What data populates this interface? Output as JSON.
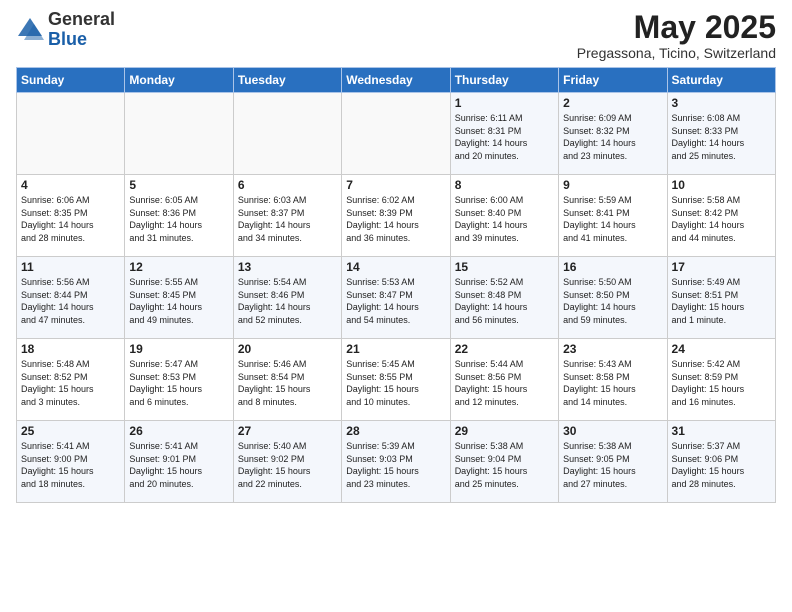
{
  "logo": {
    "general": "General",
    "blue": "Blue"
  },
  "title": "May 2025",
  "subtitle": "Pregassona, Ticino, Switzerland",
  "days_header": [
    "Sunday",
    "Monday",
    "Tuesday",
    "Wednesday",
    "Thursday",
    "Friday",
    "Saturday"
  ],
  "weeks": [
    [
      {
        "day": "",
        "info": ""
      },
      {
        "day": "",
        "info": ""
      },
      {
        "day": "",
        "info": ""
      },
      {
        "day": "",
        "info": ""
      },
      {
        "day": "1",
        "info": "Sunrise: 6:11 AM\nSunset: 8:31 PM\nDaylight: 14 hours\nand 20 minutes."
      },
      {
        "day": "2",
        "info": "Sunrise: 6:09 AM\nSunset: 8:32 PM\nDaylight: 14 hours\nand 23 minutes."
      },
      {
        "day": "3",
        "info": "Sunrise: 6:08 AM\nSunset: 8:33 PM\nDaylight: 14 hours\nand 25 minutes."
      }
    ],
    [
      {
        "day": "4",
        "info": "Sunrise: 6:06 AM\nSunset: 8:35 PM\nDaylight: 14 hours\nand 28 minutes."
      },
      {
        "day": "5",
        "info": "Sunrise: 6:05 AM\nSunset: 8:36 PM\nDaylight: 14 hours\nand 31 minutes."
      },
      {
        "day": "6",
        "info": "Sunrise: 6:03 AM\nSunset: 8:37 PM\nDaylight: 14 hours\nand 34 minutes."
      },
      {
        "day": "7",
        "info": "Sunrise: 6:02 AM\nSunset: 8:39 PM\nDaylight: 14 hours\nand 36 minutes."
      },
      {
        "day": "8",
        "info": "Sunrise: 6:00 AM\nSunset: 8:40 PM\nDaylight: 14 hours\nand 39 minutes."
      },
      {
        "day": "9",
        "info": "Sunrise: 5:59 AM\nSunset: 8:41 PM\nDaylight: 14 hours\nand 41 minutes."
      },
      {
        "day": "10",
        "info": "Sunrise: 5:58 AM\nSunset: 8:42 PM\nDaylight: 14 hours\nand 44 minutes."
      }
    ],
    [
      {
        "day": "11",
        "info": "Sunrise: 5:56 AM\nSunset: 8:44 PM\nDaylight: 14 hours\nand 47 minutes."
      },
      {
        "day": "12",
        "info": "Sunrise: 5:55 AM\nSunset: 8:45 PM\nDaylight: 14 hours\nand 49 minutes."
      },
      {
        "day": "13",
        "info": "Sunrise: 5:54 AM\nSunset: 8:46 PM\nDaylight: 14 hours\nand 52 minutes."
      },
      {
        "day": "14",
        "info": "Sunrise: 5:53 AM\nSunset: 8:47 PM\nDaylight: 14 hours\nand 54 minutes."
      },
      {
        "day": "15",
        "info": "Sunrise: 5:52 AM\nSunset: 8:48 PM\nDaylight: 14 hours\nand 56 minutes."
      },
      {
        "day": "16",
        "info": "Sunrise: 5:50 AM\nSunset: 8:50 PM\nDaylight: 14 hours\nand 59 minutes."
      },
      {
        "day": "17",
        "info": "Sunrise: 5:49 AM\nSunset: 8:51 PM\nDaylight: 15 hours\nand 1 minute."
      }
    ],
    [
      {
        "day": "18",
        "info": "Sunrise: 5:48 AM\nSunset: 8:52 PM\nDaylight: 15 hours\nand 3 minutes."
      },
      {
        "day": "19",
        "info": "Sunrise: 5:47 AM\nSunset: 8:53 PM\nDaylight: 15 hours\nand 6 minutes."
      },
      {
        "day": "20",
        "info": "Sunrise: 5:46 AM\nSunset: 8:54 PM\nDaylight: 15 hours\nand 8 minutes."
      },
      {
        "day": "21",
        "info": "Sunrise: 5:45 AM\nSunset: 8:55 PM\nDaylight: 15 hours\nand 10 minutes."
      },
      {
        "day": "22",
        "info": "Sunrise: 5:44 AM\nSunset: 8:56 PM\nDaylight: 15 hours\nand 12 minutes."
      },
      {
        "day": "23",
        "info": "Sunrise: 5:43 AM\nSunset: 8:58 PM\nDaylight: 15 hours\nand 14 minutes."
      },
      {
        "day": "24",
        "info": "Sunrise: 5:42 AM\nSunset: 8:59 PM\nDaylight: 15 hours\nand 16 minutes."
      }
    ],
    [
      {
        "day": "25",
        "info": "Sunrise: 5:41 AM\nSunset: 9:00 PM\nDaylight: 15 hours\nand 18 minutes."
      },
      {
        "day": "26",
        "info": "Sunrise: 5:41 AM\nSunset: 9:01 PM\nDaylight: 15 hours\nand 20 minutes."
      },
      {
        "day": "27",
        "info": "Sunrise: 5:40 AM\nSunset: 9:02 PM\nDaylight: 15 hours\nand 22 minutes."
      },
      {
        "day": "28",
        "info": "Sunrise: 5:39 AM\nSunset: 9:03 PM\nDaylight: 15 hours\nand 23 minutes."
      },
      {
        "day": "29",
        "info": "Sunrise: 5:38 AM\nSunset: 9:04 PM\nDaylight: 15 hours\nand 25 minutes."
      },
      {
        "day": "30",
        "info": "Sunrise: 5:38 AM\nSunset: 9:05 PM\nDaylight: 15 hours\nand 27 minutes."
      },
      {
        "day": "31",
        "info": "Sunrise: 5:37 AM\nSunset: 9:06 PM\nDaylight: 15 hours\nand 28 minutes."
      }
    ]
  ]
}
